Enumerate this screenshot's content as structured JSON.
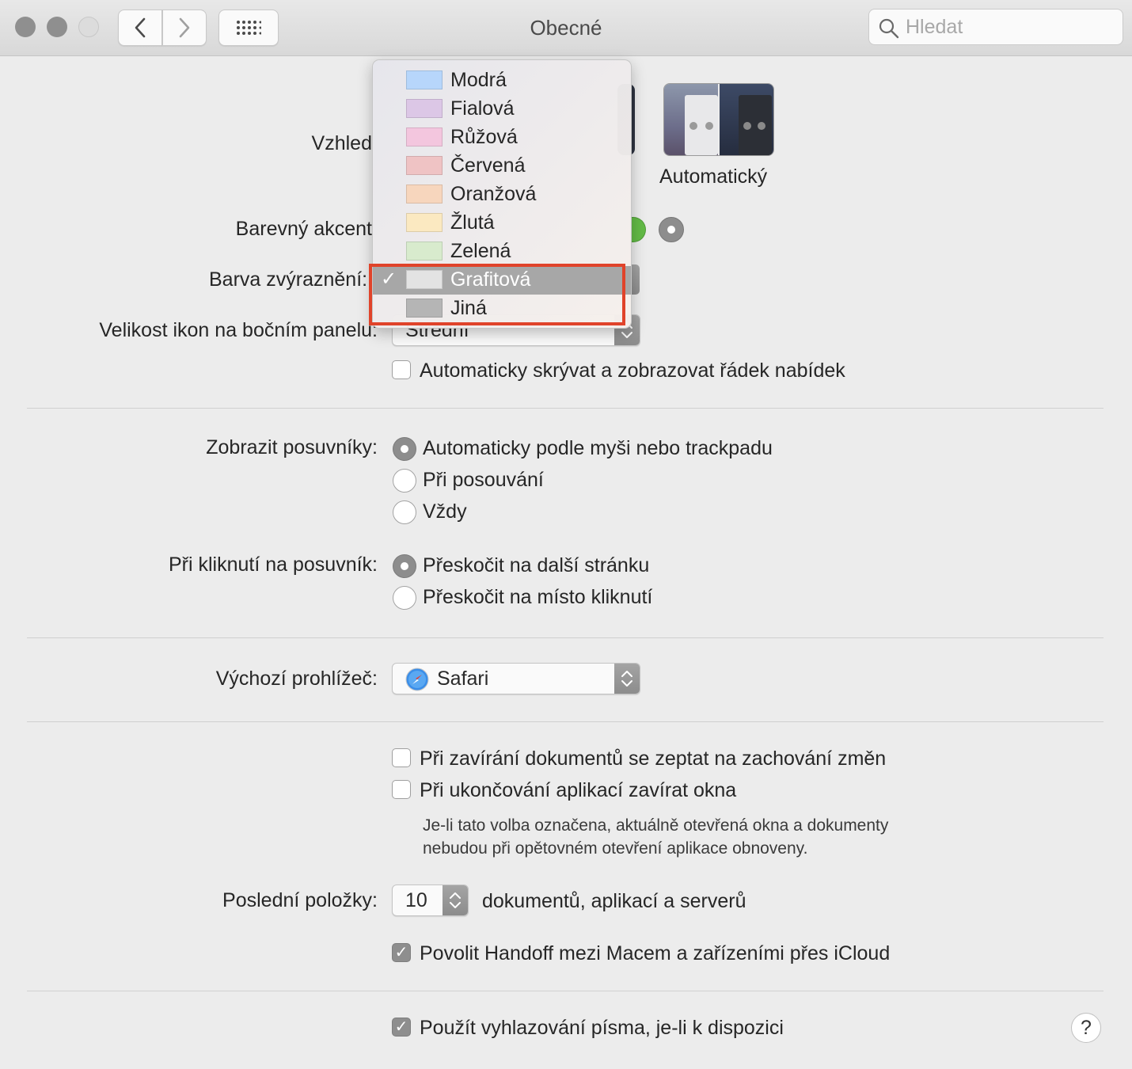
{
  "window": {
    "title": "Obecné"
  },
  "toolbar": {
    "search_placeholder": "Hledat"
  },
  "appearance": {
    "label": "Vzhled",
    "option_auto": "Automatický"
  },
  "accent": {
    "label": "Barevný akcent"
  },
  "highlight": {
    "label": "Barva zvýraznění:",
    "menu_items": [
      {
        "label": "Modrá",
        "color": "#b7d6fb"
      },
      {
        "label": "Fialová",
        "color": "#dcc7e6"
      },
      {
        "label": "Růžová",
        "color": "#f3c6de"
      },
      {
        "label": "Červená",
        "color": "#efc3c4"
      },
      {
        "label": "Oranžová",
        "color": "#f7d6bd"
      },
      {
        "label": "Žlutá",
        "color": "#fbe9c1"
      },
      {
        "label": "Zelená",
        "color": "#d8ebcd"
      },
      {
        "label": "Grafitová",
        "color": "#e3e3e3",
        "selected": true
      },
      {
        "label": "Jiná",
        "color": "#b5b5b5"
      }
    ]
  },
  "sidebar_icon_size": {
    "label": "Velikost ikon na bočním panelu:",
    "value": "Střední"
  },
  "menubar_autohide": {
    "label": "Automaticky skrývat a zobrazovat řádek nabídek",
    "checked": false
  },
  "scrollbars": {
    "label": "Zobrazit posuvníky:",
    "options": [
      "Automaticky podle myši nebo trackpadu",
      "Při posouvání",
      "Vždy"
    ],
    "selected": 0
  },
  "scrollbar_click": {
    "label": "Při kliknutí na posuvník:",
    "options": [
      "Přeskočit na další stránku",
      "Přeskočit na místo kliknutí"
    ],
    "selected": 0
  },
  "browser": {
    "label": "Výchozí prohlížeč:",
    "value": "Safari"
  },
  "ask_keep_changes": {
    "label": "Při zavírání dokumentů se zeptat na zachování změn",
    "checked": false
  },
  "close_windows": {
    "label": "Při ukončování aplikací zavírat okna",
    "checked": false,
    "note_line1": "Je-li tato volba označena, aktuálně otevřená okna a dokumenty",
    "note_line2": "nebudou při opětovném otevření aplikace obnoveny."
  },
  "recent_items": {
    "label": "Poslední položky:",
    "value": "10",
    "suffix": "dokumentů, aplikací a serverů"
  },
  "handoff": {
    "label": "Povolit Handoff mezi Macem a zařízeními přes iCloud",
    "checked": true
  },
  "font_smoothing": {
    "label": "Použít vyhlazování písma, je-li k dispozici",
    "checked": true
  },
  "help": {
    "label": "?"
  }
}
